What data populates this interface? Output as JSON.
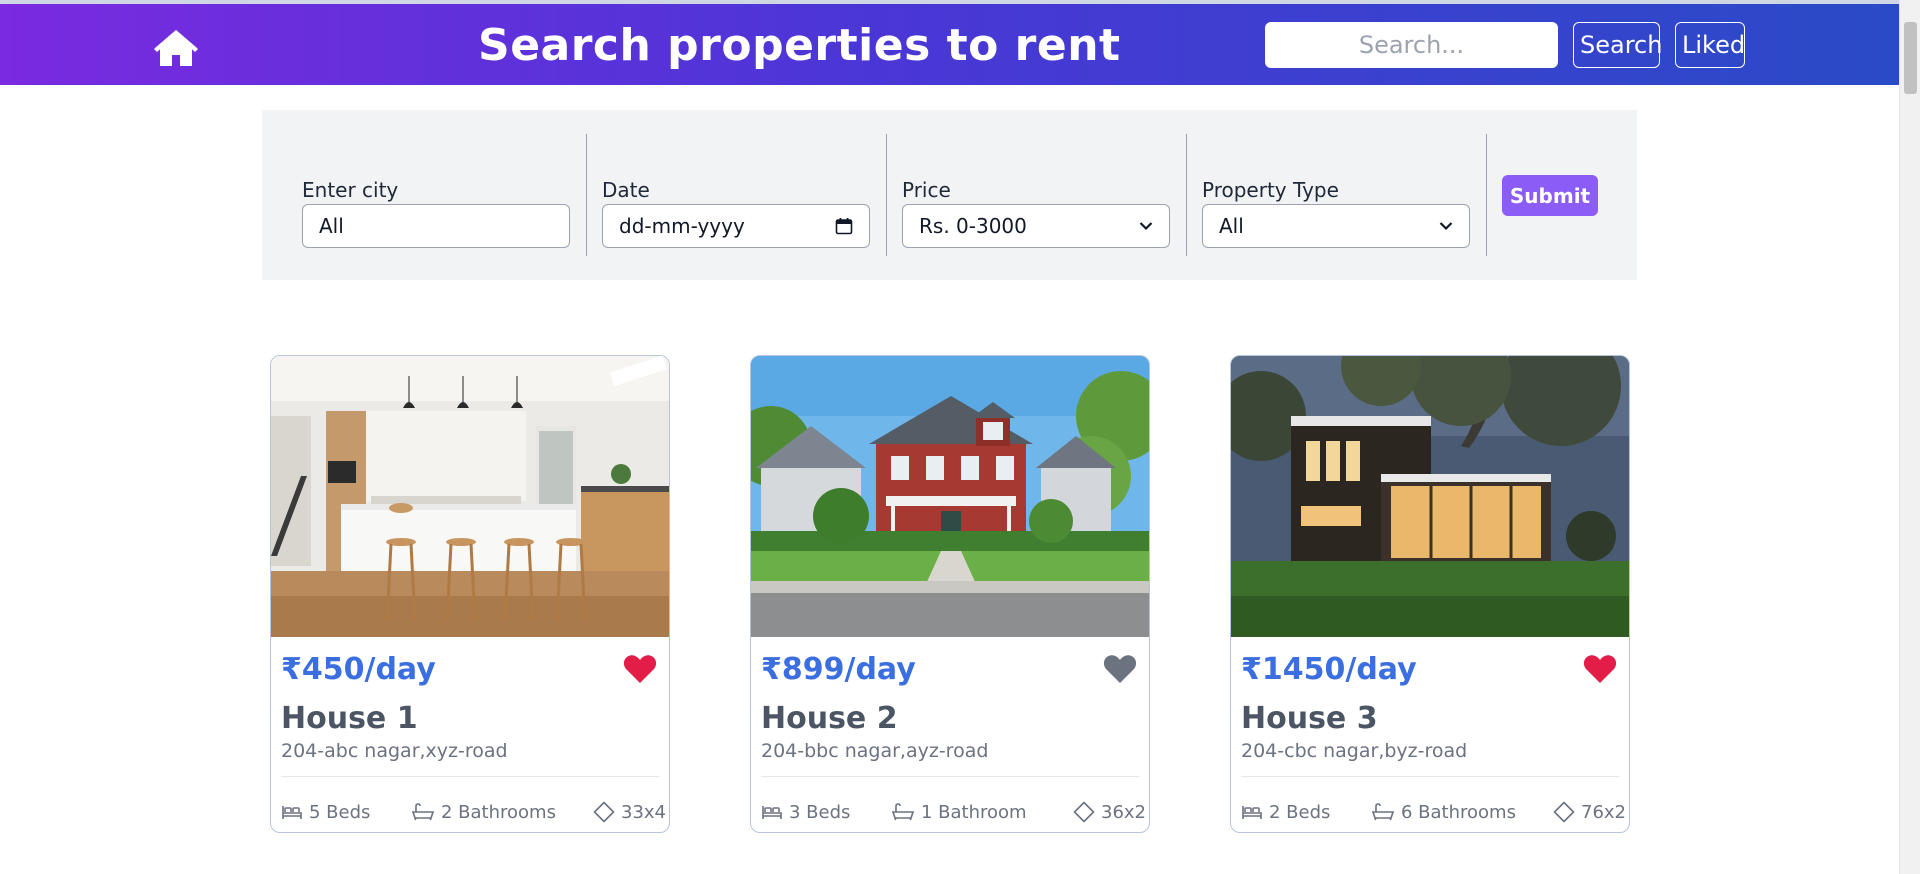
{
  "header": {
    "title": "Search properties to rent",
    "search_placeholder": "Search...",
    "search_button": "Search",
    "liked_button": "Liked"
  },
  "filters": {
    "city": {
      "label": "Enter city",
      "value": "All"
    },
    "date": {
      "label": "Date",
      "value": "dd-mm-yyyy"
    },
    "price": {
      "label": "Price",
      "value": "Rs. 0-3000"
    },
    "property_type": {
      "label": "Property Type",
      "value": "All"
    },
    "submit": "Submit"
  },
  "listings": [
    {
      "price": "₹450/day",
      "title": "House 1",
      "address": "204-abc nagar,xyz-road",
      "beds": "5 Beds",
      "baths": "2 Bathrooms",
      "area": "33x4",
      "liked": true,
      "image": "modern-kitchen"
    },
    {
      "price": "₹899/day",
      "title": "House 2",
      "address": "204-bbc nagar,ayz-road",
      "beds": "3 Beds",
      "baths": "1 Bathroom",
      "area": "36x2",
      "liked": false,
      "image": "red-house"
    },
    {
      "price": "₹1450/day",
      "title": "House 3",
      "address": "204-cbc nagar,byz-road",
      "beds": "2 Beds",
      "baths": "6 Bathrooms",
      "area": "76x2",
      "liked": true,
      "image": "modern-house-night"
    }
  ],
  "colors": {
    "accent": "#3b6ee0",
    "liked": "#e11d48",
    "unliked": "#6b7280",
    "submit": "#8b5cf6"
  }
}
